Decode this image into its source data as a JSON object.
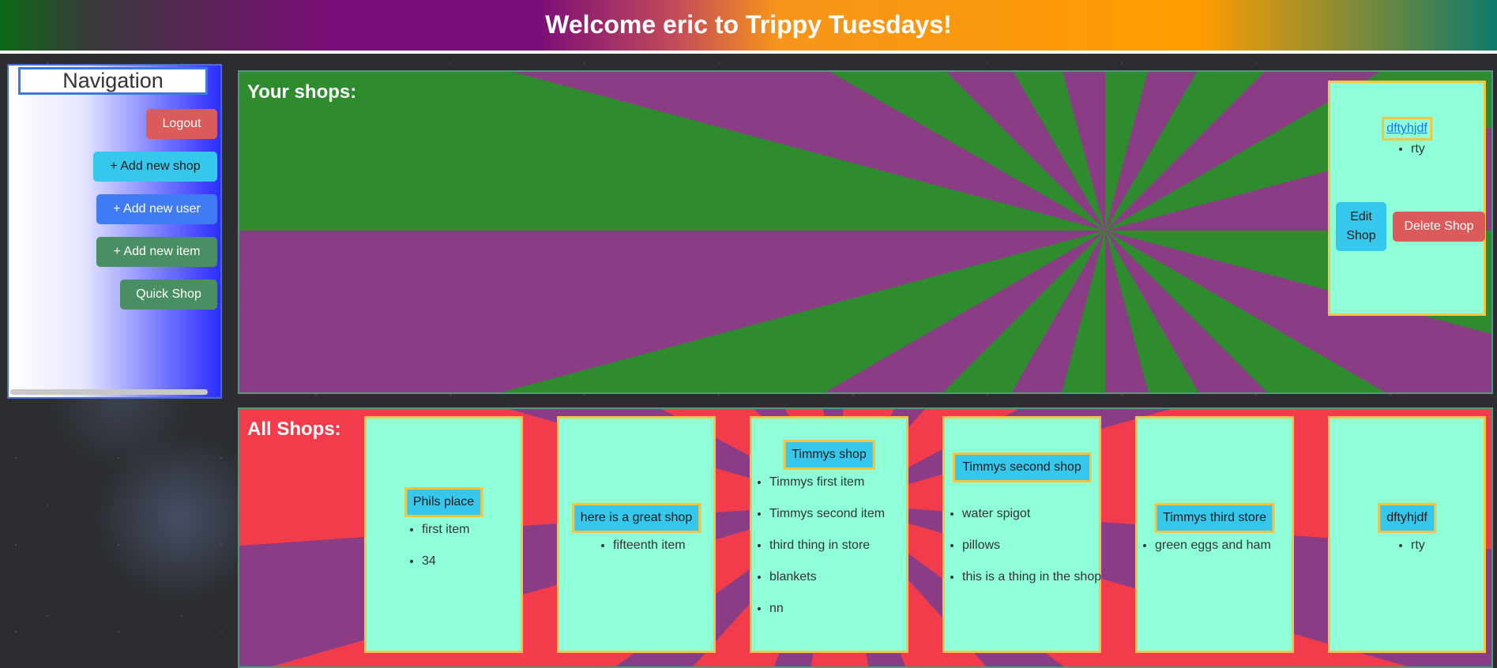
{
  "header": {
    "title": "Welcome eric to Trippy Tuesdays!"
  },
  "nav": {
    "title": "Navigation",
    "logout": "Logout",
    "add_shop": "+ Add new shop",
    "add_user": "+ Add new user",
    "add_item": "+ Add new item",
    "quick_shop": "Quick Shop"
  },
  "your_shops": {
    "title": "Your shops:",
    "shops": [
      {
        "name": "dftyhjdf",
        "items": [
          "rty"
        ],
        "edit_label": "Edit Shop",
        "delete_label": "Delete Shop"
      }
    ]
  },
  "all_shops": {
    "title": "All Shops:",
    "shops": [
      {
        "name": "Phils place",
        "items": [
          "first item",
          "34"
        ]
      },
      {
        "name": "here is a great shop",
        "items": [
          "fifteenth item"
        ]
      },
      {
        "name": "Timmys shop",
        "items": [
          "Timmys first item",
          "Timmys second item",
          "third thing in store",
          "blankets",
          "nn"
        ]
      },
      {
        "name": "Timmys second shop",
        "items": [
          "water spigot",
          "pillows",
          "this is a thing in the shop"
        ]
      },
      {
        "name": "Timmys third store",
        "items": [
          "green eggs and ham"
        ]
      },
      {
        "name": "dftyhjdf",
        "items": [
          "rty"
        ]
      }
    ]
  },
  "colors": {
    "card_bg": "#8effd6",
    "card_border": "#f5c542",
    "shop_name_bg": "#36c8ec",
    "delete_red": "#dc5a5a"
  }
}
